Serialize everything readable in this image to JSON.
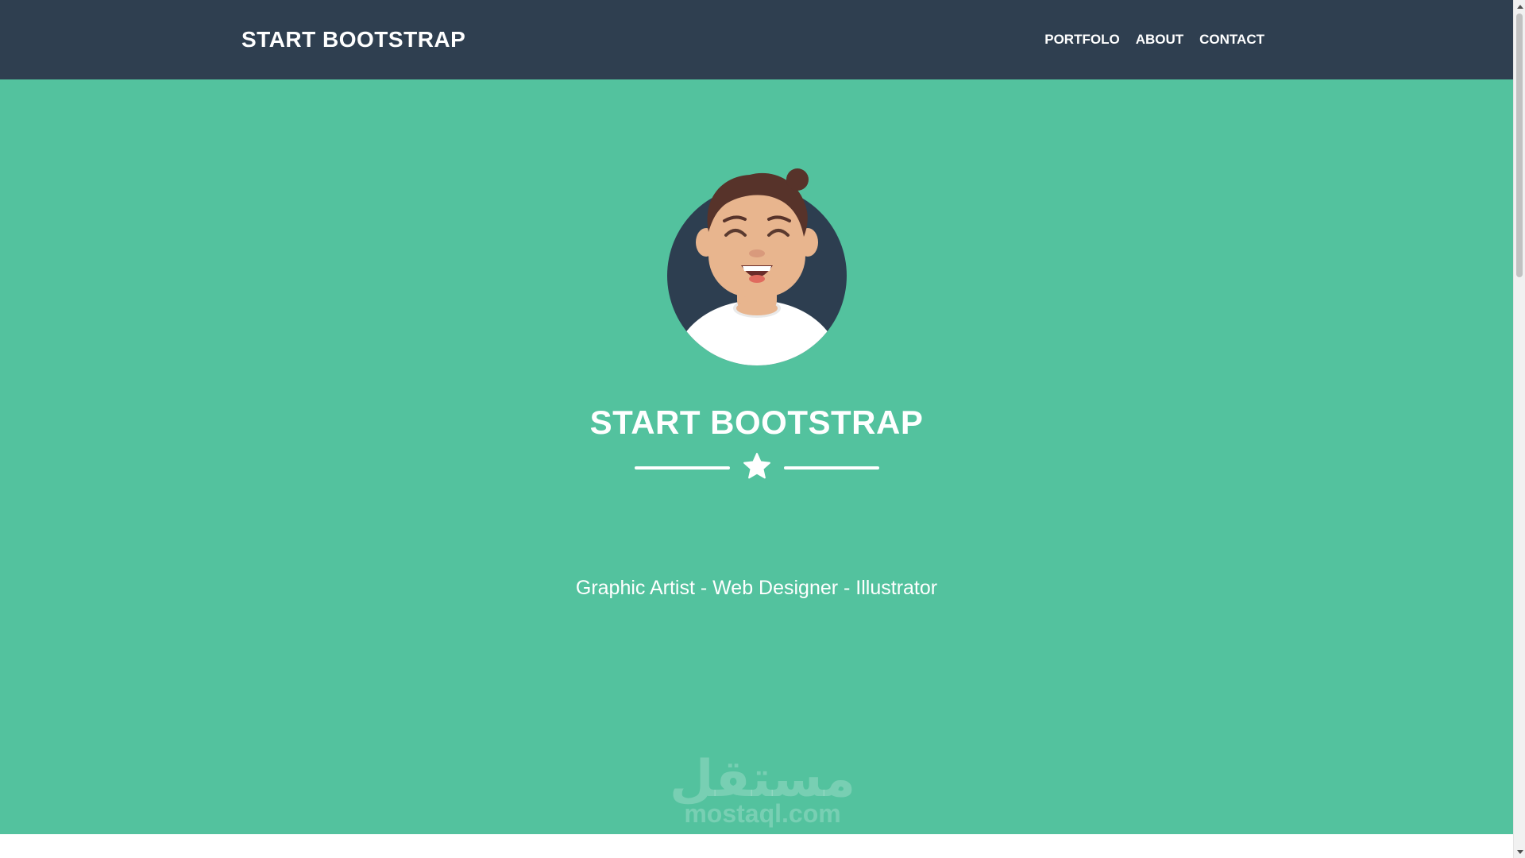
{
  "navbar": {
    "brand": "START BOOTSTRAP",
    "links": [
      {
        "label": "PORTFOLO"
      },
      {
        "label": "ABOUT"
      },
      {
        "label": "CONTACT"
      }
    ],
    "background": "#2f3f50"
  },
  "hero": {
    "title": "START BOOTSTRAP",
    "subtitle": "Graphic Artist - Web Designer - Illustrator",
    "background": "#53c29e",
    "avatar_icon": "avatar-illustration",
    "divider_icon": "star-icon"
  },
  "watermark": {
    "arabic": "مستقل",
    "latin": "mostaql.com"
  }
}
